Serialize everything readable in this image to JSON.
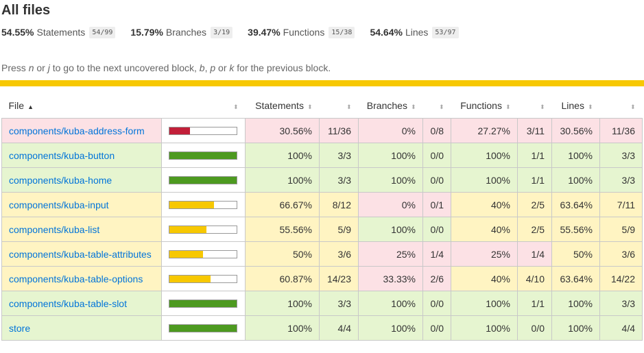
{
  "page": {
    "title": "All files"
  },
  "summary": [
    {
      "pct": "54.55%",
      "name": "Statements",
      "frac": "54/99"
    },
    {
      "pct": "15.79%",
      "name": "Branches",
      "frac": "3/19"
    },
    {
      "pct": "39.47%",
      "name": "Functions",
      "frac": "15/38"
    },
    {
      "pct": "54.64%",
      "name": "Lines",
      "frac": "53/97"
    }
  ],
  "help": {
    "p1": "Press ",
    "k1": "n",
    "p2": " or ",
    "k2": "j",
    "p3": " to go to the next uncovered block, ",
    "k3": "b",
    "p4": ", ",
    "k4": "p",
    "p5": " or ",
    "k5": "k",
    "p6": " for the previous block."
  },
  "colors": {
    "stripe": "#f7c802",
    "low_bg": "#fce1e5",
    "medium_bg": "#fff4c2",
    "high_bg": "#e6f5d0",
    "low_bar": "#c21f39",
    "medium_bar": "#f7c802",
    "high_bar": "#4d9a20",
    "link": "#0074d9"
  },
  "table": {
    "headers": {
      "file": "File",
      "statements": "Statements",
      "branches": "Branches",
      "functions": "Functions",
      "lines": "Lines"
    },
    "icons": {
      "sort_active": "sort-ascending-icon",
      "sort": "sort-icon"
    },
    "rows": [
      {
        "file": "components/kuba-address-form",
        "level": "low",
        "coverage": 0.3056,
        "stmt_pct": "30.56%",
        "stmt_frac": "11/36",
        "stmt_level": "low",
        "br_pct": "0%",
        "br_frac": "0/8",
        "br_level": "low",
        "fn_pct": "27.27%",
        "fn_frac": "3/11",
        "fn_level": "low",
        "ln_pct": "30.56%",
        "ln_frac": "11/36",
        "ln_level": "low"
      },
      {
        "file": "components/kuba-button",
        "level": "high",
        "coverage": 1.0,
        "stmt_pct": "100%",
        "stmt_frac": "3/3",
        "stmt_level": "high",
        "br_pct": "100%",
        "br_frac": "0/0",
        "br_level": "high",
        "fn_pct": "100%",
        "fn_frac": "1/1",
        "fn_level": "high",
        "ln_pct": "100%",
        "ln_frac": "3/3",
        "ln_level": "high"
      },
      {
        "file": "components/kuba-home",
        "level": "high",
        "coverage": 1.0,
        "stmt_pct": "100%",
        "stmt_frac": "3/3",
        "stmt_level": "high",
        "br_pct": "100%",
        "br_frac": "0/0",
        "br_level": "high",
        "fn_pct": "100%",
        "fn_frac": "1/1",
        "fn_level": "high",
        "ln_pct": "100%",
        "ln_frac": "3/3",
        "ln_level": "high"
      },
      {
        "file": "components/kuba-input",
        "level": "medium",
        "coverage": 0.6667,
        "stmt_pct": "66.67%",
        "stmt_frac": "8/12",
        "stmt_level": "medium",
        "br_pct": "0%",
        "br_frac": "0/1",
        "br_level": "low",
        "fn_pct": "40%",
        "fn_frac": "2/5",
        "fn_level": "medium",
        "ln_pct": "63.64%",
        "ln_frac": "7/11",
        "ln_level": "medium"
      },
      {
        "file": "components/kuba-list",
        "level": "medium",
        "coverage": 0.5556,
        "stmt_pct": "55.56%",
        "stmt_frac": "5/9",
        "stmt_level": "medium",
        "br_pct": "100%",
        "br_frac": "0/0",
        "br_level": "high",
        "fn_pct": "40%",
        "fn_frac": "2/5",
        "fn_level": "medium",
        "ln_pct": "55.56%",
        "ln_frac": "5/9",
        "ln_level": "medium"
      },
      {
        "file": "components/kuba-table-attributes",
        "level": "medium",
        "coverage": 0.5,
        "stmt_pct": "50%",
        "stmt_frac": "3/6",
        "stmt_level": "medium",
        "br_pct": "25%",
        "br_frac": "1/4",
        "br_level": "low",
        "fn_pct": "25%",
        "fn_frac": "1/4",
        "fn_level": "low",
        "ln_pct": "50%",
        "ln_frac": "3/6",
        "ln_level": "medium"
      },
      {
        "file": "components/kuba-table-options",
        "level": "medium",
        "coverage": 0.6087,
        "stmt_pct": "60.87%",
        "stmt_frac": "14/23",
        "stmt_level": "medium",
        "br_pct": "33.33%",
        "br_frac": "2/6",
        "br_level": "low",
        "fn_pct": "40%",
        "fn_frac": "4/10",
        "fn_level": "medium",
        "ln_pct": "63.64%",
        "ln_frac": "14/22",
        "ln_level": "medium"
      },
      {
        "file": "components/kuba-table-slot",
        "level": "high",
        "coverage": 1.0,
        "stmt_pct": "100%",
        "stmt_frac": "3/3",
        "stmt_level": "high",
        "br_pct": "100%",
        "br_frac": "0/0",
        "br_level": "high",
        "fn_pct": "100%",
        "fn_frac": "1/1",
        "fn_level": "high",
        "ln_pct": "100%",
        "ln_frac": "3/3",
        "ln_level": "high"
      },
      {
        "file": "store",
        "level": "high",
        "coverage": 1.0,
        "stmt_pct": "100%",
        "stmt_frac": "4/4",
        "stmt_level": "high",
        "br_pct": "100%",
        "br_frac": "0/0",
        "br_level": "high",
        "fn_pct": "100%",
        "fn_frac": "0/0",
        "fn_level": "high",
        "ln_pct": "100%",
        "ln_frac": "4/4",
        "ln_level": "high"
      }
    ]
  }
}
